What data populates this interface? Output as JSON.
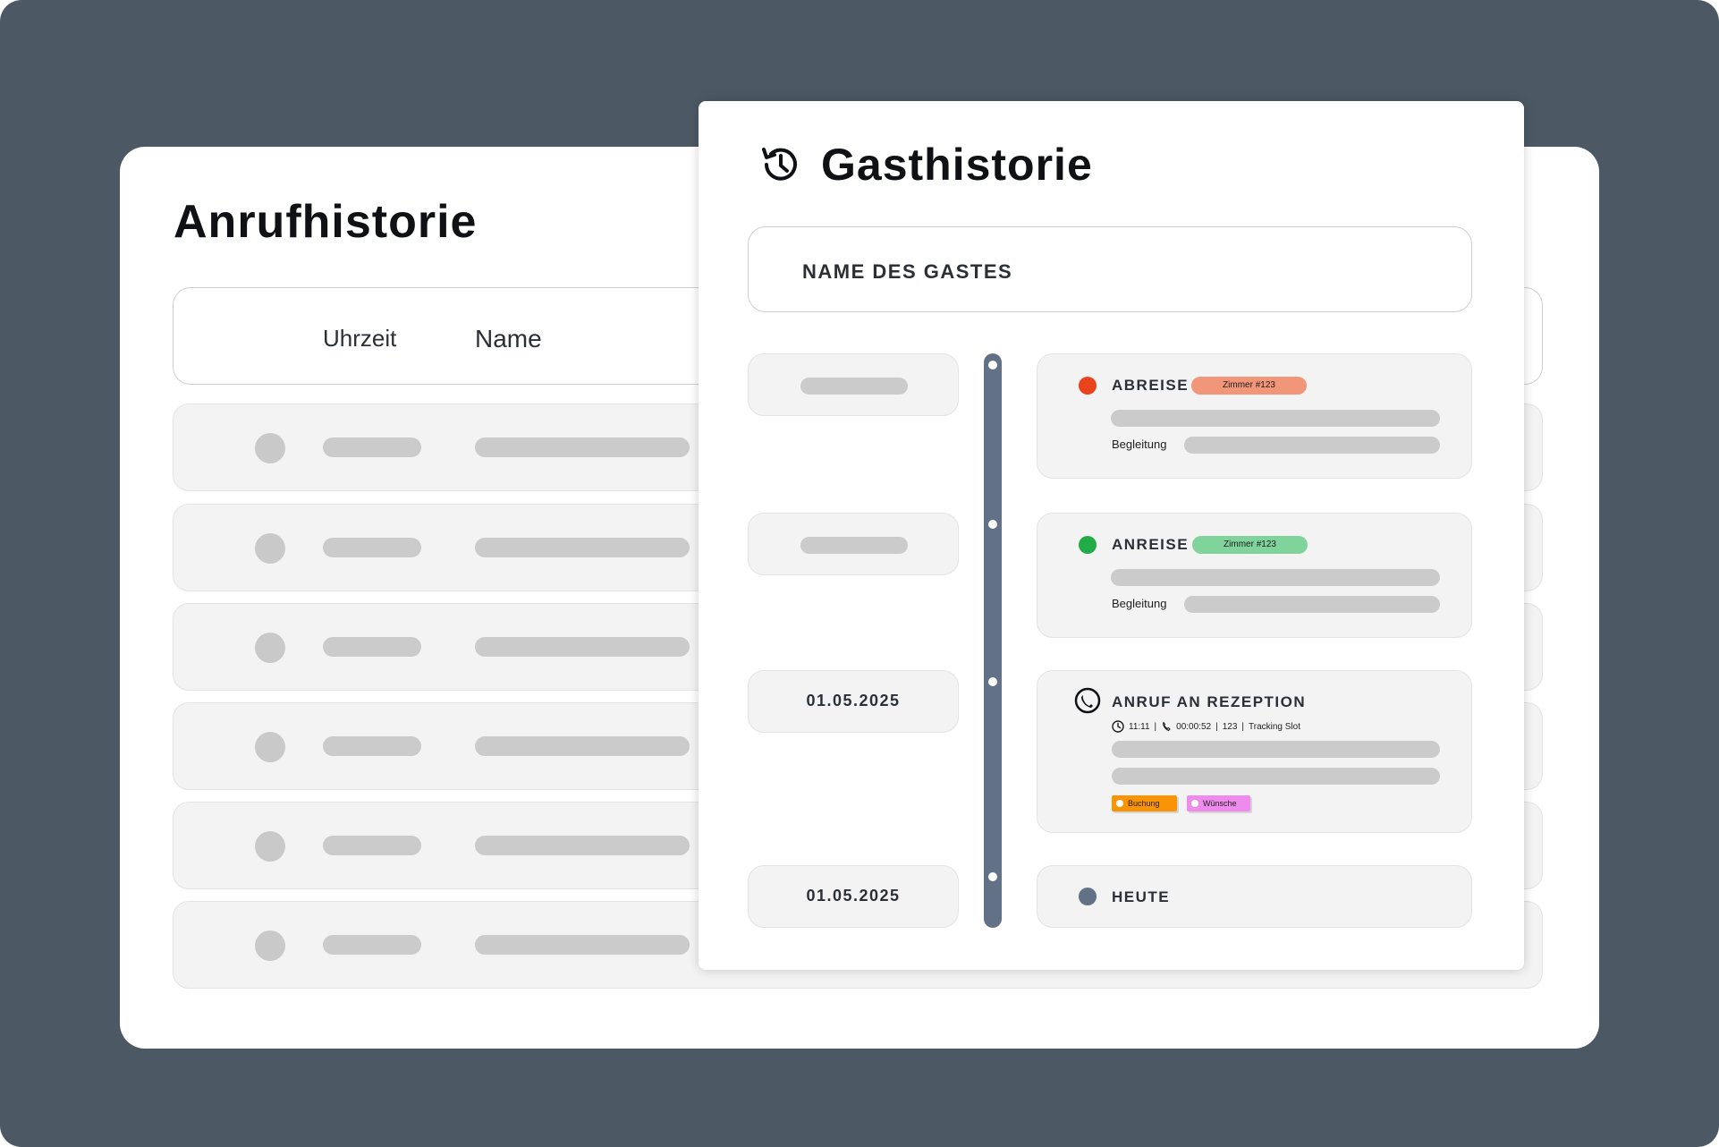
{
  "back_card": {
    "title": "Anrufhistorie",
    "columns": {
      "time": "Uhrzeit",
      "name": "Name"
    },
    "rows": 6
  },
  "front_card": {
    "title": "Gasthistorie",
    "icon": "history-icon",
    "guest_name_label": "NAME DES GASTES",
    "timeline": [
      {
        "date": "",
        "type": "ABREISE",
        "status_color": "#e9431e",
        "room": "Zimmer #123",
        "room_color": "#f2967a",
        "companion_label": "Begleitung"
      },
      {
        "date": "",
        "type": "ANREISE",
        "status_color": "#22ac48",
        "room": "Zimmer #123",
        "room_color": "#80d49b",
        "companion_label": "Begleitung"
      },
      {
        "date": "01.05.2025",
        "type": "ANRUF AN REZEPTION",
        "icon": "phone-icon",
        "time": "11:11",
        "duration": "00:00:52",
        "room_number": "123",
        "slot": "Tracking Slot",
        "separator": "|",
        "tags": [
          {
            "label": "Buchung",
            "color": "#f99406"
          },
          {
            "label": "Wünsche",
            "color": "#ef8bed"
          }
        ]
      },
      {
        "date": "01.05.2025",
        "type": "HEUTE",
        "status_color": "#637186"
      }
    ]
  },
  "colors": {
    "backdrop": "#4c5965",
    "card": "#ffffff",
    "row_bg": "#f3f3f3",
    "placeholder": "#cbcbcb",
    "timeline_track": "#637186"
  }
}
